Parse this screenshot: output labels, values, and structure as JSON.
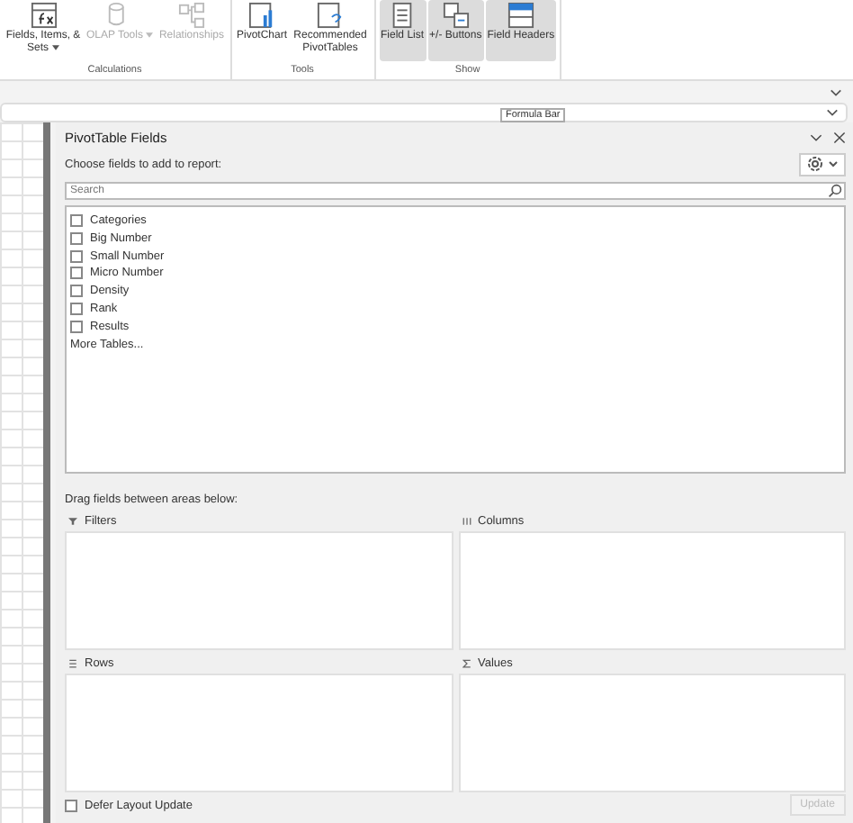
{
  "ribbon": {
    "groups": [
      {
        "label": "Calculations",
        "buttons": [
          {
            "label": "Fields, Items, & Sets",
            "dropdown": true,
            "disabled": false,
            "selected": false
          },
          {
            "label": "OLAP Tools",
            "dropdown": true,
            "disabled": true,
            "selected": false
          },
          {
            "label": "Relationships",
            "dropdown": false,
            "disabled": true,
            "selected": false
          }
        ]
      },
      {
        "label": "Tools",
        "buttons": [
          {
            "label": "PivotChart",
            "dropdown": false,
            "disabled": false,
            "selected": false
          },
          {
            "label": "Recommended PivotTables",
            "dropdown": false,
            "disabled": false,
            "selected": false
          }
        ]
      },
      {
        "label": "Show",
        "buttons": [
          {
            "label": "Field List",
            "dropdown": false,
            "disabled": false,
            "selected": true
          },
          {
            "label": "+/- Buttons",
            "dropdown": false,
            "disabled": false,
            "selected": true
          },
          {
            "label": "Field Headers",
            "dropdown": false,
            "disabled": false,
            "selected": true
          }
        ]
      }
    ]
  },
  "formula_bar": {
    "tooltip": "Formula Bar"
  },
  "pane": {
    "title": "PivotTable Fields",
    "subtitle": "Choose fields to add to report:",
    "search": {
      "placeholder": "Search"
    },
    "fields": [
      {
        "label": "Categories",
        "checked": false
      },
      {
        "label": "Big Number",
        "checked": false
      },
      {
        "label": "Small Number",
        "checked": false
      },
      {
        "label": "Micro Number",
        "checked": false
      },
      {
        "label": "Density",
        "checked": false
      },
      {
        "label": "Rank",
        "checked": false
      },
      {
        "label": "Results",
        "checked": false
      }
    ],
    "more_tables": "More Tables...",
    "areas_hint": "Drag fields between areas below:",
    "areas": [
      {
        "label": "Filters",
        "kind": "filter"
      },
      {
        "label": "Columns",
        "kind": "columns"
      },
      {
        "label": "Rows",
        "kind": "rows"
      },
      {
        "label": "Values",
        "kind": "values"
      }
    ],
    "defer": {
      "label": "Defer Layout Update",
      "checked": false
    },
    "update_button": {
      "label": "Update",
      "disabled": true
    }
  }
}
